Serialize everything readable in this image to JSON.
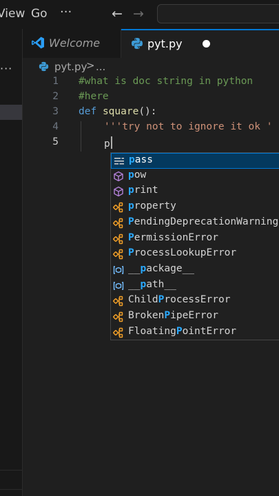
{
  "menu": {
    "view": "View",
    "go": "Go",
    "more": "···"
  },
  "nav": {
    "back": "←",
    "forward": "→"
  },
  "sidebar": {
    "more": "···"
  },
  "tabs": [
    {
      "label": "Welcome",
      "icon": "vscode-icon"
    },
    {
      "label": "pyt.py",
      "icon": "python-icon",
      "modified": true
    }
  ],
  "breadcrumb": {
    "file": "pyt.py",
    "separator": ">",
    "ellipsis": "..."
  },
  "editor": {
    "lines": [
      {
        "number": "1",
        "text": "#what is doc string in python"
      },
      {
        "number": "2",
        "text": "#here"
      },
      {
        "number": "3",
        "keyword": "def",
        "function": "square",
        "rest": "():"
      },
      {
        "number": "4",
        "text": "'''try not to ignore it ok '"
      },
      {
        "number": "5",
        "text": "p"
      }
    ]
  },
  "suggestions": [
    {
      "pre": "",
      "match": "p",
      "post": "ass",
      "kind": "keyword",
      "selected": true
    },
    {
      "pre": "",
      "match": "p",
      "post": "ow",
      "kind": "function"
    },
    {
      "pre": "",
      "match": "p",
      "post": "rint",
      "kind": "function"
    },
    {
      "pre": "",
      "match": "p",
      "post": "roperty",
      "kind": "class"
    },
    {
      "pre": "",
      "match": "P",
      "post": "endingDeprecationWarning",
      "kind": "class"
    },
    {
      "pre": "",
      "match": "P",
      "post": "ermissionError",
      "kind": "class"
    },
    {
      "pre": "",
      "match": "P",
      "post": "rocessLookupError",
      "kind": "class"
    },
    {
      "pre": "__",
      "match": "p",
      "post": "ackage__",
      "kind": "variable"
    },
    {
      "pre": "__",
      "match": "p",
      "post": "ath__",
      "kind": "variable"
    },
    {
      "pre": "Child",
      "match": "P",
      "post": "rocessError",
      "kind": "class"
    },
    {
      "pre": "Broken",
      "match": "P",
      "post": "ipeError",
      "kind": "class"
    },
    {
      "pre": "Floating",
      "match": "P",
      "post": "ointError",
      "kind": "class"
    }
  ],
  "colors": {
    "accent": "#0078d4",
    "match_highlight": "#2aaaff",
    "comment": "#6a9955",
    "keyword": "#569cd6",
    "function_name": "#dcdcaa",
    "string": "#ce9178",
    "class_icon": "#ee9d28",
    "function_icon": "#b180d7",
    "variable_icon": "#75beff"
  }
}
